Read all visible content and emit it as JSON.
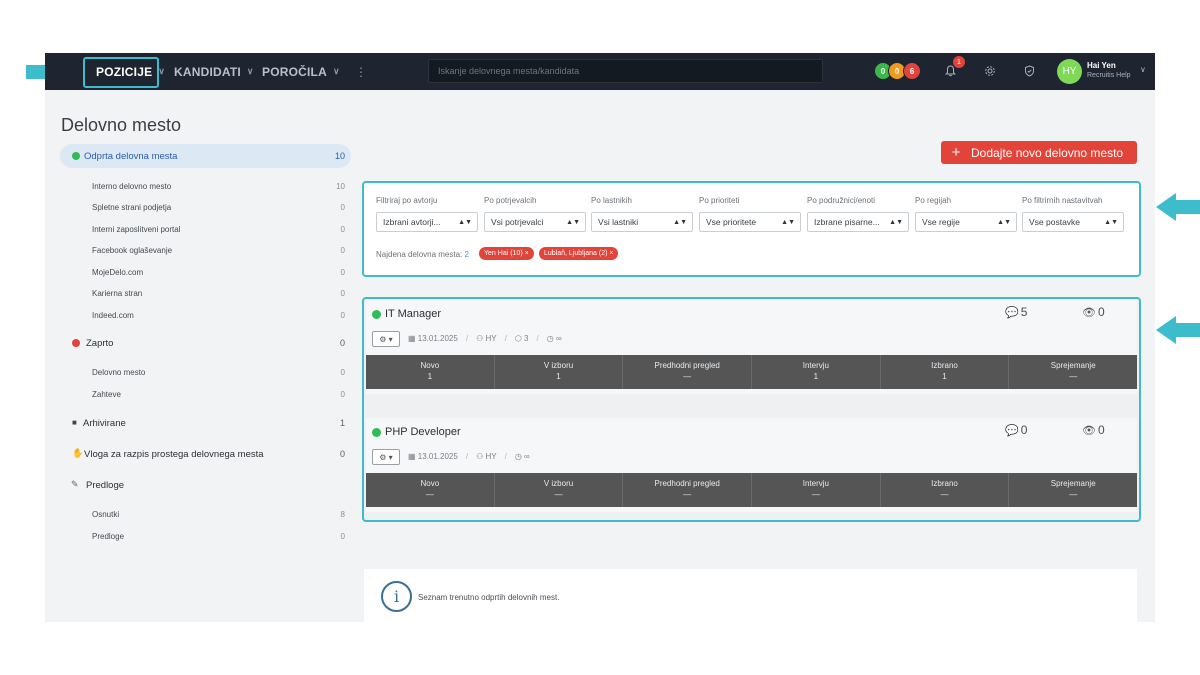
{
  "nav": {
    "items": [
      {
        "label": "POZICIJE",
        "active": true
      },
      {
        "label": "KANDIDATI",
        "active": false
      },
      {
        "label": "POROČILA",
        "active": false
      }
    ],
    "more": "⋮",
    "search_placeholder": "Iskanje delovnega mesta/kandidata",
    "status_pills": [
      {
        "value": "0",
        "color": "#3cb84a"
      },
      {
        "value": "0",
        "color": "#f29a1f"
      },
      {
        "value": "6",
        "color": "#e2433c"
      }
    ],
    "notifications_count": "1",
    "user": {
      "initials": "HY",
      "name": "Hai Yen",
      "subtitle": "Recruitis Help"
    }
  },
  "page": {
    "title": "Delovno mesto"
  },
  "sidebar": {
    "open_positions": {
      "label": "Odprta delovna mesta",
      "count": "10",
      "children": [
        {
          "label": "Interno delovno mesto",
          "count": "10"
        },
        {
          "label": "Spletne strani podjetja",
          "count": "0"
        },
        {
          "label": "Interni zaposlitveni portal",
          "count": "0"
        },
        {
          "label": "Facebook oglaševanje",
          "count": "0"
        },
        {
          "label": "MojeDelo.com",
          "count": "0"
        },
        {
          "label": "Karierna stran",
          "count": "0"
        },
        {
          "label": "Indeed.com",
          "count": "0"
        }
      ]
    },
    "closed": {
      "label": "Zaprto",
      "count": "0",
      "children": [
        {
          "label": "Delovno mesto",
          "count": "0"
        },
        {
          "label": "Zahteve",
          "count": "0"
        }
      ]
    },
    "archived": {
      "label": "Arhivirane",
      "count": "1"
    },
    "request": {
      "label": "Vloga za razpis prostega delovnega mesta",
      "count": "0"
    },
    "templates": {
      "label": "Predloge",
      "children": [
        {
          "label": "Osnutki",
          "count": "8"
        },
        {
          "label": "Predloge",
          "count": "0"
        }
      ]
    }
  },
  "main": {
    "add_button": "Dodajte novo delovno mesto",
    "filters": [
      {
        "label": "Filtriraj po avtorju",
        "value": "Izbrani avtorji..."
      },
      {
        "label": "Po potrjevalcih",
        "value": "Vsi potrjevalci"
      },
      {
        "label": "Po lastnikih",
        "value": "Vsi lastniki"
      },
      {
        "label": "Po prioriteti",
        "value": "Vse prioritete"
      },
      {
        "label": "Po podružnici/enoti",
        "value": "Izbrane pisarne..."
      },
      {
        "label": "Po regijah",
        "value": "Vse regije"
      },
      {
        "label": "Po filtrirnih nastavitvah",
        "value": "Vse postavke"
      }
    ],
    "found_label": "Najdena delovna mesta:",
    "found_count": "2",
    "tags": [
      "Yen Hai (10) ×",
      "Lublaň, Ljubljana (2) ×"
    ],
    "jobs": [
      {
        "title": "IT Manager",
        "comments": "5",
        "views": "0",
        "date": "13.01.2025",
        "owner": "HY",
        "tags": "3",
        "deadline": "∞",
        "stages": [
          {
            "name": "Novo",
            "value": "1"
          },
          {
            "name": "V izboru",
            "value": "1"
          },
          {
            "name": "Predhodni pregled",
            "value": "—"
          },
          {
            "name": "Intervju",
            "value": "1"
          },
          {
            "name": "Izbrano",
            "value": "1"
          },
          {
            "name": "Sprejemanje",
            "value": "—"
          }
        ]
      },
      {
        "title": "PHP Developer",
        "comments": "0",
        "views": "0",
        "date": "13.01.2025",
        "owner": "HY",
        "deadline": "∞",
        "stages": [
          {
            "name": "Novo",
            "value": "—"
          },
          {
            "name": "V izboru",
            "value": "—"
          },
          {
            "name": "Predhodni pregled",
            "value": "—"
          },
          {
            "name": "Intervju",
            "value": "—"
          },
          {
            "name": "Izbrano",
            "value": "—"
          },
          {
            "name": "Sprejemanje",
            "value": "—"
          }
        ]
      }
    ],
    "info_text": "Seznam trenutno odprtih delovnih mest."
  }
}
